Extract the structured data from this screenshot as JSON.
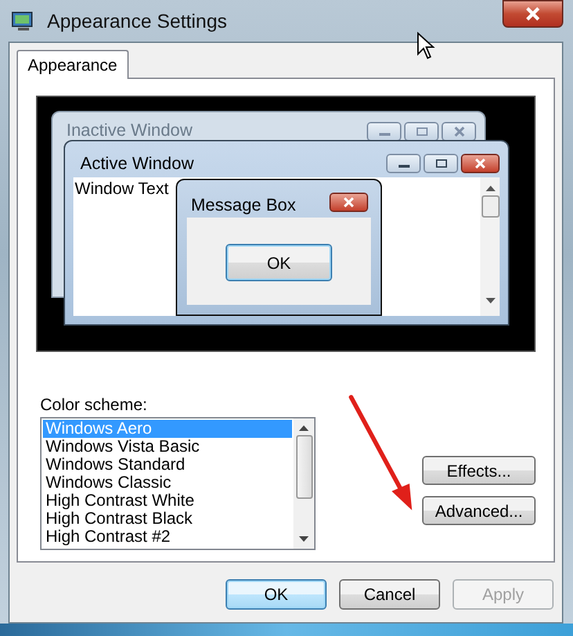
{
  "window": {
    "title": "Appearance Settings"
  },
  "tabs": [
    {
      "label": "Appearance",
      "selected": true
    }
  ],
  "preview": {
    "inactive_window": {
      "title": "Inactive Window"
    },
    "active_window": {
      "title": "Active Window",
      "text": "Window Text"
    },
    "message_box": {
      "title": "Message Box",
      "button": "OK"
    }
  },
  "color_scheme": {
    "label": "Color scheme:",
    "items": [
      {
        "label": "Windows Aero",
        "selected": true
      },
      {
        "label": "Windows Vista Basic",
        "selected": false
      },
      {
        "label": "Windows Standard",
        "selected": false
      },
      {
        "label": "Windows Classic",
        "selected": false
      },
      {
        "label": "High Contrast White",
        "selected": false
      },
      {
        "label": "High Contrast Black",
        "selected": false
      },
      {
        "label": "High Contrast #2",
        "selected": false
      }
    ]
  },
  "side_buttons": [
    {
      "label": "Effects..."
    },
    {
      "label": "Advanced..."
    }
  ],
  "footer_buttons": [
    {
      "label": "OK",
      "default": true,
      "disabled": false
    },
    {
      "label": "Cancel",
      "default": false,
      "disabled": false
    },
    {
      "label": "Apply",
      "default": false,
      "disabled": true
    }
  ]
}
